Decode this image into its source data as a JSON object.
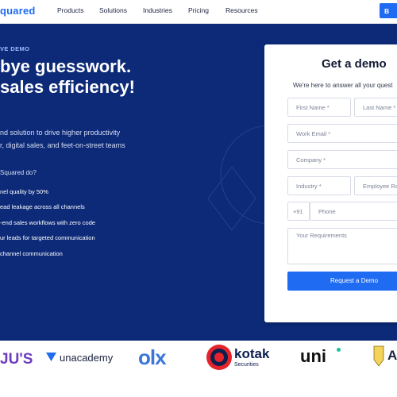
{
  "brand": {
    "logo_text": "quared"
  },
  "nav": {
    "items": [
      "Products",
      "Solutions",
      "Industries",
      "Pricing",
      "Resources"
    ],
    "cta_label": "B"
  },
  "hero": {
    "eyebrow": "VE DEMO",
    "headline_line1": "bye guesswork.",
    "headline_line2": "sales efficiency!",
    "subtext_line1": "nd solution to drive higher productivity",
    "subtext_line2": "r, digital sales, and feet-on-street teams",
    "question": "Squared do?",
    "benefits": [
      "nel quality by 50%",
      "ead leakage across all channels",
      "-end sales workflows with zero code",
      "ur leads for targeted communication",
      "channel communication"
    ]
  },
  "form": {
    "title": "Get a demo",
    "subtitle": "We're here to answer all your quest",
    "first_name_placeholder": "First Name *",
    "last_name_placeholder": "Last Name *",
    "work_email_placeholder": "Work Email *",
    "company_placeholder": "Company *",
    "industry_placeholder": "Industry *",
    "employee_range_placeholder": "Employee Ra",
    "phone_code": "+91",
    "phone_placeholder": "Phone",
    "requirements_placeholder": "Your Requirements",
    "submit_label": "Request a Demo"
  },
  "clients": {
    "byjus": "JU'S",
    "unacademy": "unacademy",
    "olx": "olx",
    "kotak_name": "kotak",
    "kotak_sub": "Securities",
    "uni": "uni",
    "partial": "A"
  },
  "colors": {
    "brand_blue": "#1f6bf2",
    "hero_bg": "#0d2a78"
  }
}
